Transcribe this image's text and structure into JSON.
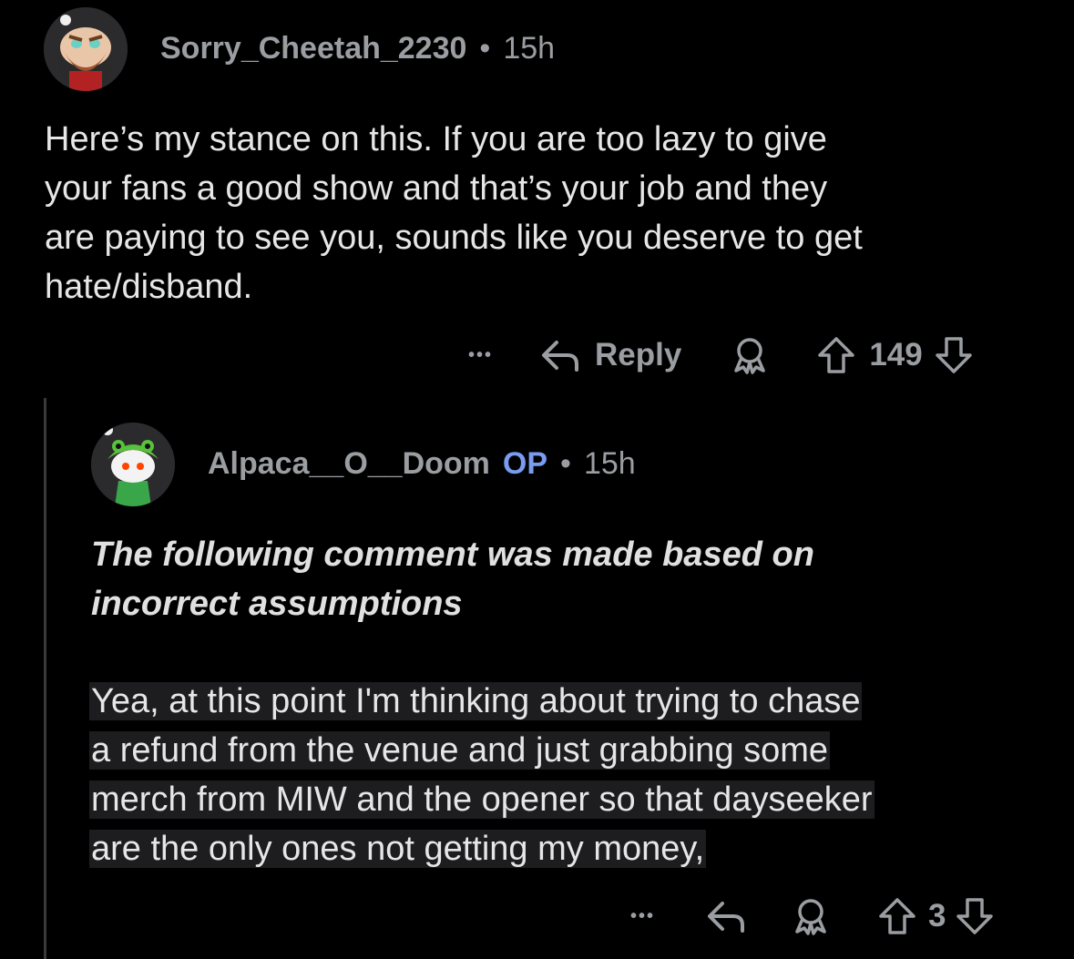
{
  "comment1": {
    "username": "Sorry_Cheetah_2230",
    "separator": "•",
    "time": "15h",
    "text_lines": [
      "Here’s my stance on this. If you are too lazy to give",
      "your fans a good show and that’s your job and they",
      "are paying to see you, sounds like you deserve to get",
      "hate/disband."
    ],
    "more": "•••",
    "reply_label": "Reply",
    "score": "149"
  },
  "comment2": {
    "username": "Alpaca__O__Doom",
    "op_badge": "OP",
    "separator": "•",
    "time": "15h",
    "note_lines": [
      "The following comment was made based on",
      "incorrect assumptions"
    ],
    "text_lines": [
      "Yea, at this point I'm thinking about trying to chase",
      "a refund from the venue and just grabbing some",
      "merch from MIW and the opener so that dayseeker",
      "are the only ones not getting my money,"
    ],
    "more": "•••",
    "score": "3"
  },
  "colors": {
    "background": "#000000",
    "muted": "#9a9da1",
    "op_accent": "#7a9cf0",
    "highlight": "#1d1d1f",
    "thread_line": "#3a3a3c"
  },
  "icons": {
    "reply": "reply-arrow-icon",
    "award": "award-icon",
    "upvote": "upvote-arrow-icon",
    "downvote": "downvote-arrow-icon"
  }
}
